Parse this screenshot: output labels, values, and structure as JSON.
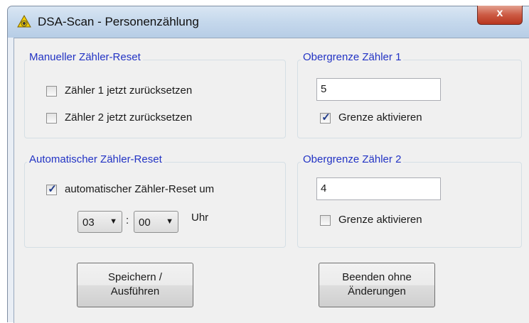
{
  "window": {
    "title": "DSA-Scan - Personenzählung",
    "close_label": "x"
  },
  "manual_reset": {
    "title": "Manueller Zähler-Reset",
    "counter1_label": "Zähler 1 jetzt zurücksetzen",
    "counter1_checked": false,
    "counter2_label": "Zähler 2 jetzt zurücksetzen",
    "counter2_checked": false
  },
  "limit1": {
    "title": "Obergrenze Zähler 1",
    "value": "5",
    "activate_label": "Grenze aktivieren",
    "activate_checked": true
  },
  "auto_reset": {
    "title": "Automatischer Zähler-Reset",
    "checkbox_label": "automatischer Zähler-Reset um",
    "checkbox_checked": true,
    "hour": "03",
    "separator": ":",
    "minute": "00",
    "unit": "Uhr"
  },
  "limit2": {
    "title": "Obergrenze Zähler 2",
    "value": "4",
    "activate_label": "Grenze aktivieren",
    "activate_checked": false
  },
  "buttons": {
    "save_line1": "Speichern /",
    "save_line2": "Ausführen",
    "quit_line1": "Beenden ohne",
    "quit_line2": "Änderungen"
  },
  "checkmark_glyph": "✓"
}
